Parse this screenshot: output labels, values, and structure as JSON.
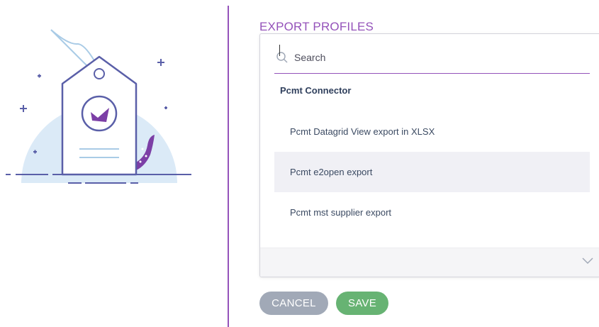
{
  "section_title": "EXPORT PROFILES",
  "search": {
    "placeholder": "Search",
    "icon": "search-icon"
  },
  "group": {
    "label": "Pcmt Connector",
    "options": [
      {
        "label": "Pcmt Datagrid View export in XLSX"
      },
      {
        "label": "Pcmt e2open export",
        "highlighted": true
      },
      {
        "label": "Pcmt mst supplier export"
      }
    ]
  },
  "footer": {
    "icon": "chevron-down-icon"
  },
  "buttons": {
    "cancel": "CANCEL",
    "save": "SAVE"
  },
  "colors": {
    "accent": "#9452ba",
    "cancel": "#a1a9b7",
    "save": "#67b373",
    "highlight": "#f0f0f5",
    "illustration_blue": "#dbeaf7",
    "illustration_line": "#5a5fa8"
  }
}
